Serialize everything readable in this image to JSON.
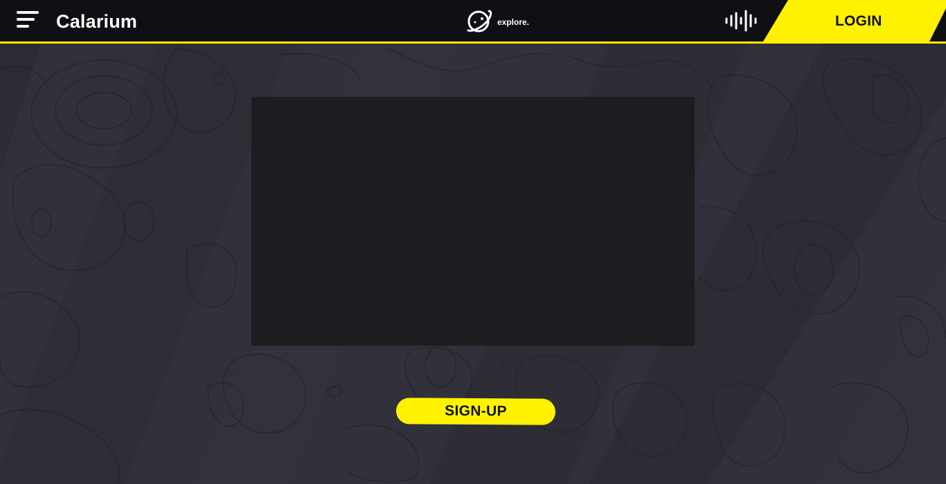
{
  "header": {
    "brand": "Calarium",
    "explore_label": "explore.",
    "login_label": "LOGIN",
    "icons": {
      "menu": "hamburger-menu-icon",
      "explore": "planet-icon",
      "audio": "sound-wave-icon"
    }
  },
  "main": {
    "signup_label": "SIGN-UP"
  },
  "colors": {
    "accent": "#fff200",
    "header_bg": "#0f1013",
    "page_bg": "#30313a",
    "panel_bg": "#1c1d21"
  }
}
